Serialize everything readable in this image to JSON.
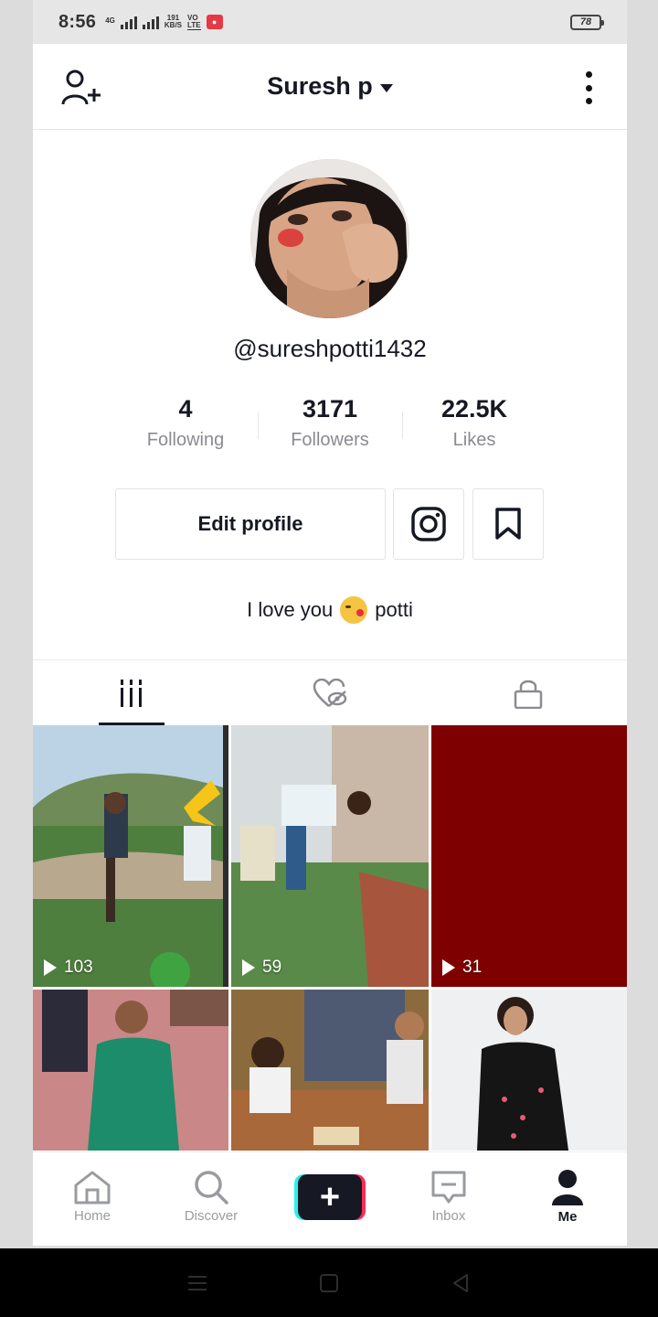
{
  "status_bar": {
    "time": "8:56",
    "network_label": "4G",
    "speed_value": "191",
    "speed_unit": "KB/S",
    "volte_top": "VO",
    "volte_bottom": "LTE",
    "battery": "78"
  },
  "header": {
    "title": "Suresh p",
    "add_user_icon": "add-user-icon",
    "more_icon": "more-vertical-icon"
  },
  "profile": {
    "username": "@sureshpotti1432",
    "stats": [
      {
        "value": "4",
        "label": "Following"
      },
      {
        "value": "3171",
        "label": "Followers"
      },
      {
        "value": "22.5K",
        "label": "Likes"
      }
    ],
    "edit_button": "Edit profile",
    "bio_before": "I love you",
    "bio_after": "potti"
  },
  "tabs": [
    {
      "icon": "videos-grid-icon",
      "active": true
    },
    {
      "icon": "liked-hidden-icon",
      "active": false
    },
    {
      "icon": "lock-icon",
      "active": false
    }
  ],
  "videos": [
    {
      "views": "103"
    },
    {
      "views": "59"
    },
    {
      "views": "31"
    },
    {
      "views": ""
    },
    {
      "views": ""
    },
    {
      "views": ""
    }
  ],
  "bottom_nav": [
    {
      "label": "Home",
      "icon": "home-icon"
    },
    {
      "label": "Discover",
      "icon": "search-icon"
    },
    {
      "label": "",
      "icon": "plus-icon"
    },
    {
      "label": "Inbox",
      "icon": "inbox-icon"
    },
    {
      "label": "Me",
      "icon": "person-icon",
      "active": true
    }
  ],
  "colors": {
    "accent_red": "#fe2c55",
    "accent_cyan": "#25f4ee",
    "text_primary": "#161823",
    "text_secondary": "#8a8b91"
  }
}
